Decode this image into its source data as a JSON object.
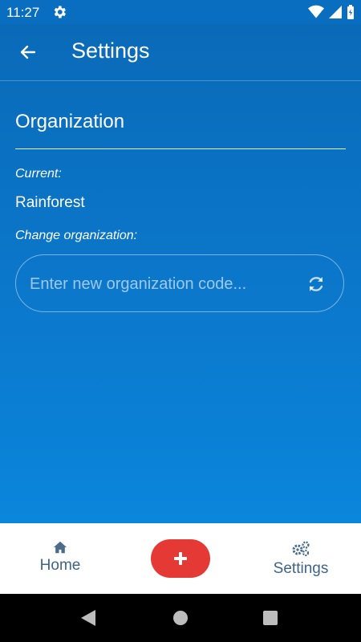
{
  "status_bar": {
    "time": "11:27"
  },
  "app_bar": {
    "title": "Settings"
  },
  "organization": {
    "heading": "Organization",
    "current_label": "Current:",
    "current_value": "Rainforest",
    "change_label": "Change organization:",
    "input_value": "",
    "input_placeholder": "Enter new organization code..."
  },
  "bottom_nav": {
    "home_label": "Home",
    "settings_label": "Settings",
    "fab_icon": "plus-icon"
  },
  "colors": {
    "background_top": "#0a6ab8",
    "background_bottom": "#0a86db",
    "fab": "#e53935",
    "nav_text": "#3f6488"
  }
}
